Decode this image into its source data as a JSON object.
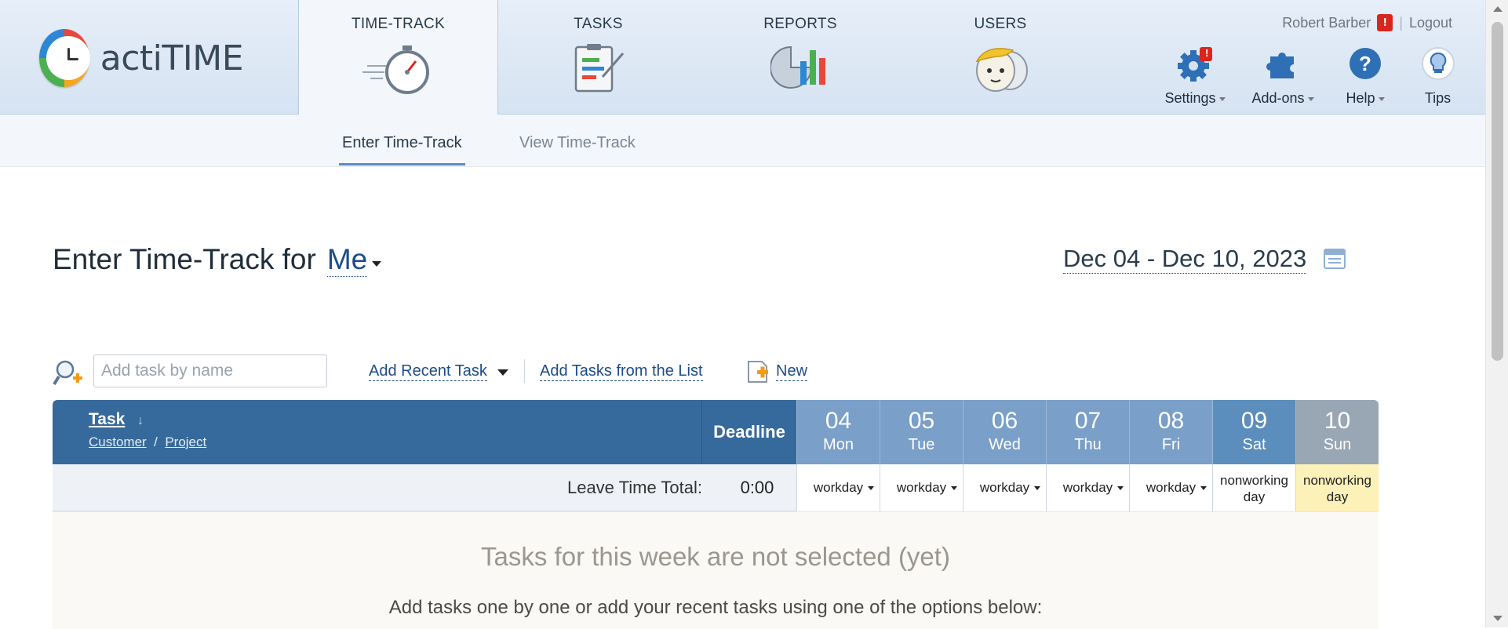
{
  "app": {
    "name": "actiTIME"
  },
  "nav": {
    "tabs": [
      {
        "label": "TIME-TRACK",
        "icon": "stopwatch-icon",
        "active": true
      },
      {
        "label": "TASKS",
        "icon": "clipboard-tasks-icon"
      },
      {
        "label": "REPORTS",
        "icon": "reports-chart-icon"
      },
      {
        "label": "USERS",
        "icon": "users-face-icon"
      }
    ]
  },
  "user": {
    "name": "Robert Barber",
    "alert": "!",
    "separator": "|",
    "logout": "Logout"
  },
  "tools": {
    "settings": {
      "label": "Settings",
      "icon": "gear-icon",
      "badge": "!"
    },
    "addons": {
      "label": "Add-ons",
      "icon": "puzzle-icon"
    },
    "help": {
      "label": "Help",
      "icon": "help-icon"
    },
    "tips": {
      "label": "Tips",
      "icon": "lightbulb-icon"
    }
  },
  "subnav": {
    "tabs": [
      {
        "label": "Enter Time-Track",
        "active": true
      },
      {
        "label": "View Time-Track"
      }
    ]
  },
  "page": {
    "title": "Enter Time-Track for",
    "user_selector": "Me",
    "date_range": "Dec 04 - Dec 10, 2023"
  },
  "addbar": {
    "placeholder": "Add task by name",
    "recent": "Add Recent Task",
    "from_list": "Add Tasks from the List",
    "new": "New"
  },
  "table": {
    "task_header": "Task",
    "customer": "Customer",
    "slash": "/",
    "project": "Project",
    "deadline_header": "Deadline",
    "days": [
      {
        "num": "04",
        "name": "Mon",
        "status": "workday"
      },
      {
        "num": "05",
        "name": "Tue",
        "status": "workday"
      },
      {
        "num": "06",
        "name": "Wed",
        "status": "workday"
      },
      {
        "num": "07",
        "name": "Thu",
        "status": "workday"
      },
      {
        "num": "08",
        "name": "Fri",
        "status": "workday"
      },
      {
        "num": "09",
        "name": "Sat",
        "status_line1": "nonworking",
        "status_line2": "day"
      },
      {
        "num": "10",
        "name": "Sun",
        "status_line1": "nonworking",
        "status_line2": "day"
      }
    ],
    "leave_label": "Leave Time Total:",
    "leave_total": "0:00",
    "empty_title": "Tasks for this week are not selected (yet)",
    "empty_subtitle": "Add tasks one by one or add your recent tasks using one of the options below:"
  },
  "colors": {
    "header_blue": "#376a9c",
    "weekday_blue": "#7a9fc8",
    "sunday_yellow": "#fcf1b8",
    "link_blue": "#1c4b8a"
  }
}
